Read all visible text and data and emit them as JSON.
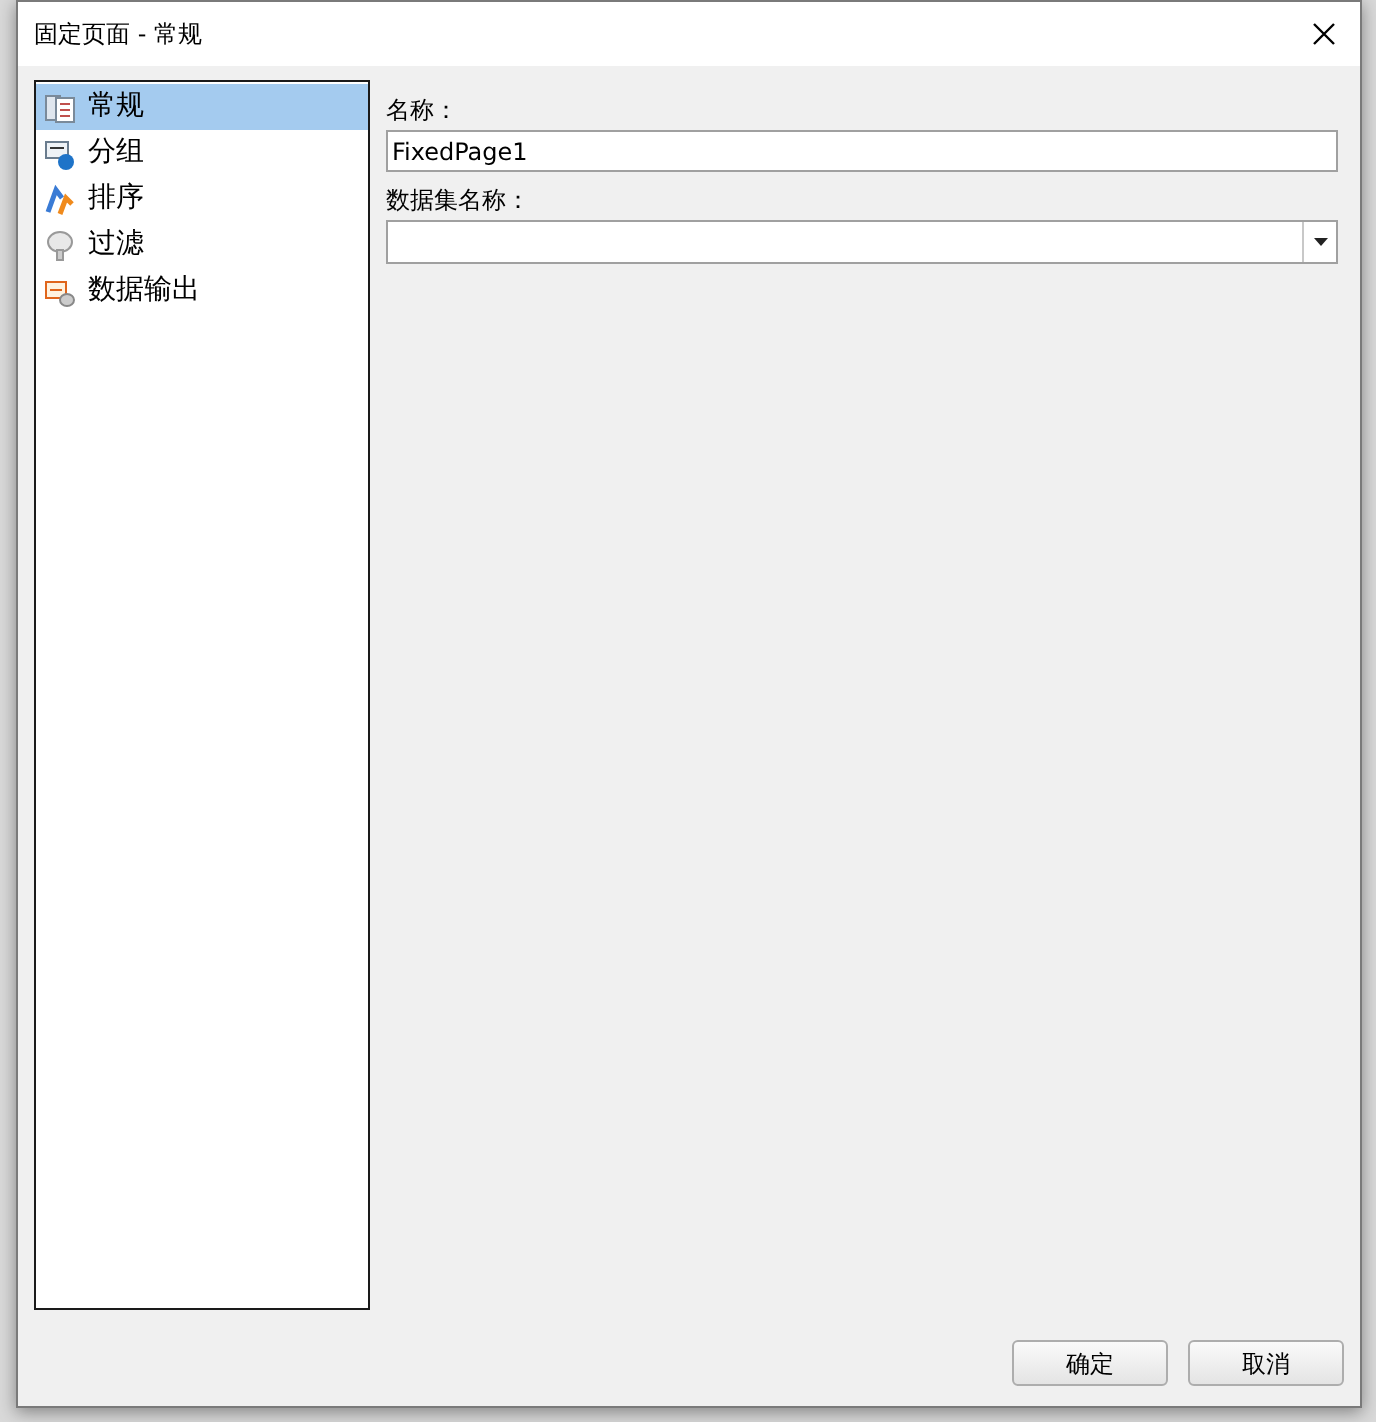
{
  "window": {
    "title": "固定页面 - 常规"
  },
  "sidebar": {
    "items": [
      {
        "label": "常规",
        "kind": "general",
        "selected": true
      },
      {
        "label": "分组",
        "kind": "group",
        "selected": false
      },
      {
        "label": "排序",
        "kind": "sort",
        "selected": false
      },
      {
        "label": "过滤",
        "kind": "filter",
        "selected": false
      },
      {
        "label": "数据输出",
        "kind": "output",
        "selected": false
      }
    ]
  },
  "form": {
    "name_label": "名称：",
    "name_value": "FixedPage1",
    "dataset_label": "数据集名称："
  },
  "buttons": [
    "确定",
    "取消"
  ]
}
